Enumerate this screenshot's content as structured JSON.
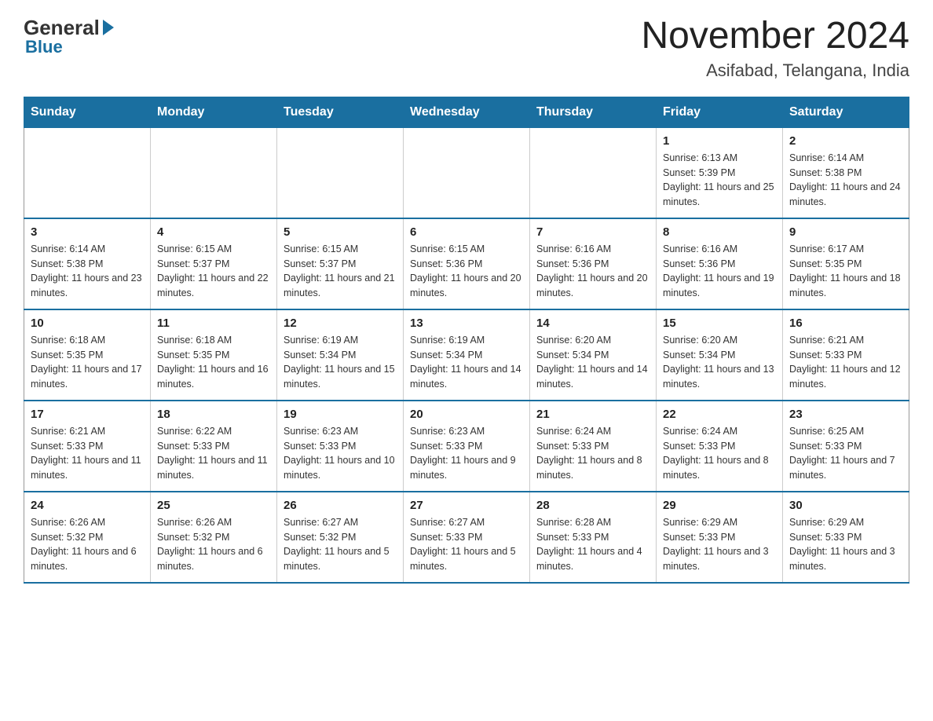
{
  "header": {
    "logo_general": "General",
    "logo_blue": "Blue",
    "month_title": "November 2024",
    "location": "Asifabad, Telangana, India"
  },
  "weekdays": [
    "Sunday",
    "Monday",
    "Tuesday",
    "Wednesday",
    "Thursday",
    "Friday",
    "Saturday"
  ],
  "weeks": [
    [
      {
        "day": "",
        "info": ""
      },
      {
        "day": "",
        "info": ""
      },
      {
        "day": "",
        "info": ""
      },
      {
        "day": "",
        "info": ""
      },
      {
        "day": "",
        "info": ""
      },
      {
        "day": "1",
        "info": "Sunrise: 6:13 AM\nSunset: 5:39 PM\nDaylight: 11 hours and 25 minutes."
      },
      {
        "day": "2",
        "info": "Sunrise: 6:14 AM\nSunset: 5:38 PM\nDaylight: 11 hours and 24 minutes."
      }
    ],
    [
      {
        "day": "3",
        "info": "Sunrise: 6:14 AM\nSunset: 5:38 PM\nDaylight: 11 hours and 23 minutes."
      },
      {
        "day": "4",
        "info": "Sunrise: 6:15 AM\nSunset: 5:37 PM\nDaylight: 11 hours and 22 minutes."
      },
      {
        "day": "5",
        "info": "Sunrise: 6:15 AM\nSunset: 5:37 PM\nDaylight: 11 hours and 21 minutes."
      },
      {
        "day": "6",
        "info": "Sunrise: 6:15 AM\nSunset: 5:36 PM\nDaylight: 11 hours and 20 minutes."
      },
      {
        "day": "7",
        "info": "Sunrise: 6:16 AM\nSunset: 5:36 PM\nDaylight: 11 hours and 20 minutes."
      },
      {
        "day": "8",
        "info": "Sunrise: 6:16 AM\nSunset: 5:36 PM\nDaylight: 11 hours and 19 minutes."
      },
      {
        "day": "9",
        "info": "Sunrise: 6:17 AM\nSunset: 5:35 PM\nDaylight: 11 hours and 18 minutes."
      }
    ],
    [
      {
        "day": "10",
        "info": "Sunrise: 6:18 AM\nSunset: 5:35 PM\nDaylight: 11 hours and 17 minutes."
      },
      {
        "day": "11",
        "info": "Sunrise: 6:18 AM\nSunset: 5:35 PM\nDaylight: 11 hours and 16 minutes."
      },
      {
        "day": "12",
        "info": "Sunrise: 6:19 AM\nSunset: 5:34 PM\nDaylight: 11 hours and 15 minutes."
      },
      {
        "day": "13",
        "info": "Sunrise: 6:19 AM\nSunset: 5:34 PM\nDaylight: 11 hours and 14 minutes."
      },
      {
        "day": "14",
        "info": "Sunrise: 6:20 AM\nSunset: 5:34 PM\nDaylight: 11 hours and 14 minutes."
      },
      {
        "day": "15",
        "info": "Sunrise: 6:20 AM\nSunset: 5:34 PM\nDaylight: 11 hours and 13 minutes."
      },
      {
        "day": "16",
        "info": "Sunrise: 6:21 AM\nSunset: 5:33 PM\nDaylight: 11 hours and 12 minutes."
      }
    ],
    [
      {
        "day": "17",
        "info": "Sunrise: 6:21 AM\nSunset: 5:33 PM\nDaylight: 11 hours and 11 minutes."
      },
      {
        "day": "18",
        "info": "Sunrise: 6:22 AM\nSunset: 5:33 PM\nDaylight: 11 hours and 11 minutes."
      },
      {
        "day": "19",
        "info": "Sunrise: 6:23 AM\nSunset: 5:33 PM\nDaylight: 11 hours and 10 minutes."
      },
      {
        "day": "20",
        "info": "Sunrise: 6:23 AM\nSunset: 5:33 PM\nDaylight: 11 hours and 9 minutes."
      },
      {
        "day": "21",
        "info": "Sunrise: 6:24 AM\nSunset: 5:33 PM\nDaylight: 11 hours and 8 minutes."
      },
      {
        "day": "22",
        "info": "Sunrise: 6:24 AM\nSunset: 5:33 PM\nDaylight: 11 hours and 8 minutes."
      },
      {
        "day": "23",
        "info": "Sunrise: 6:25 AM\nSunset: 5:33 PM\nDaylight: 11 hours and 7 minutes."
      }
    ],
    [
      {
        "day": "24",
        "info": "Sunrise: 6:26 AM\nSunset: 5:32 PM\nDaylight: 11 hours and 6 minutes."
      },
      {
        "day": "25",
        "info": "Sunrise: 6:26 AM\nSunset: 5:32 PM\nDaylight: 11 hours and 6 minutes."
      },
      {
        "day": "26",
        "info": "Sunrise: 6:27 AM\nSunset: 5:32 PM\nDaylight: 11 hours and 5 minutes."
      },
      {
        "day": "27",
        "info": "Sunrise: 6:27 AM\nSunset: 5:33 PM\nDaylight: 11 hours and 5 minutes."
      },
      {
        "day": "28",
        "info": "Sunrise: 6:28 AM\nSunset: 5:33 PM\nDaylight: 11 hours and 4 minutes."
      },
      {
        "day": "29",
        "info": "Sunrise: 6:29 AM\nSunset: 5:33 PM\nDaylight: 11 hours and 3 minutes."
      },
      {
        "day": "30",
        "info": "Sunrise: 6:29 AM\nSunset: 5:33 PM\nDaylight: 11 hours and 3 minutes."
      }
    ]
  ]
}
